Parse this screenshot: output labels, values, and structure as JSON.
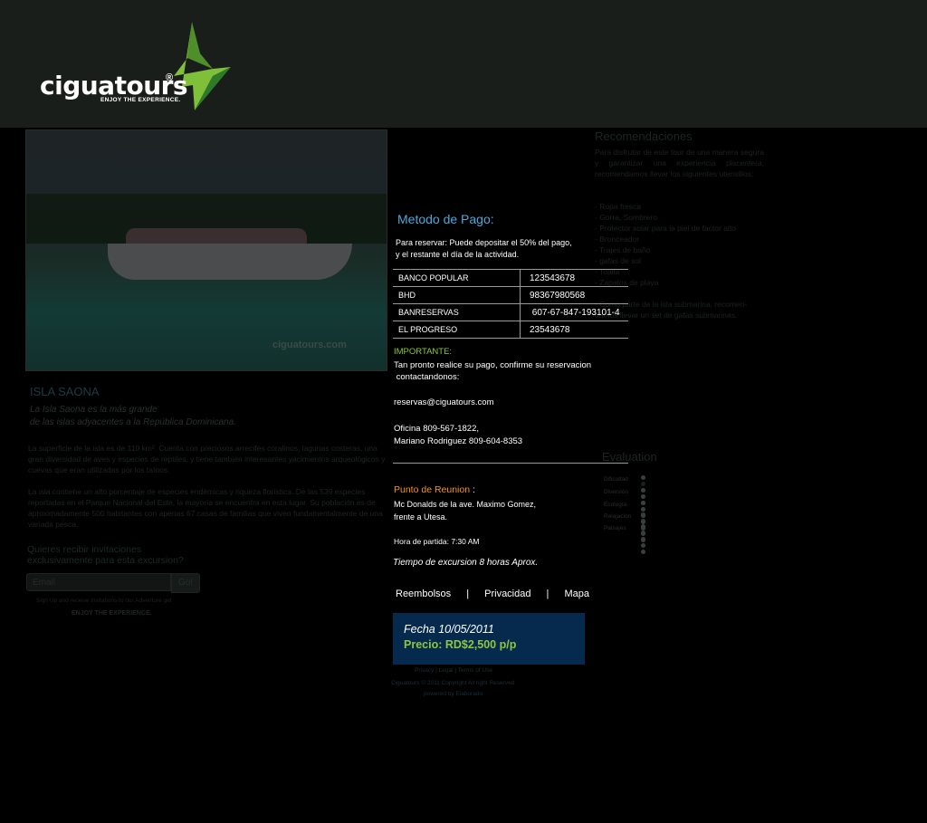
{
  "brand": {
    "logo_text": "ciguatours",
    "logo_mark": "®",
    "tagline": "ENJOY THE EXPERIENCE.",
    "colors": {
      "header_bg": "#1a1e1a",
      "accent_green": "#8ec63f",
      "accent_blue": "#4aa8dc",
      "accent_orange": "#f7941d",
      "price_box": "#062a4e"
    }
  },
  "photo": {
    "watermark": "ciguatours.com"
  },
  "isla": {
    "title": "ISLA SAONA",
    "subtitle_line1": "La Isla Saona es la más grande",
    "subtitle_line2": "de las islas adyacentes a la República Dominicana.",
    "paragraph1": "La superficie de la isla es de 110 km². Cuenta con preciosos arrecifes coralinos, lagunas costeras, una gran diversidad de aves y especies de reptiles, y tiene también interesantes yacimientos arqueológicos y cuevas que eran utilizadas por los taínos.",
    "paragraph2": "La isla contiene un alto porcentaje de especies endémicas y riqueza florística. De las 539 especies reportadas en el Parque Nacional del Este, la mayoría se encuentra en esta lugar. Su población es de aproximadamente 500 habitantes con apenas 67 casas de familias que viven fundamentalmente de una variada pesca."
  },
  "newsletter": {
    "title_line1": "Quieres recibir invitaciones",
    "title_line2": "exclusivamente para esta excursion?",
    "input_placeholder": "Email",
    "button_label": "Go!",
    "note": "Sign Up and receive invitations to our Adventure get",
    "tagline": "ENJOY THE EXPERIENCE."
  },
  "recomendaciones": {
    "title": "Recomendaciones",
    "intro": "Para disfrutar de este tour de una manera segura y garantizar una experiencia placentera, recomendamos llevar los siguientes utensilios:",
    "items": [
      "- Ropa fresca",
      "- Gorra, Sombrero",
      "- Protector solar para la piel de factor alto",
      "- Bronceador",
      "- Trajes de baño",
      "- gafas de sol",
      "- Toalla",
      "- Zapatos de playa"
    ],
    "note_line1": "- Como parte de la isla submarina, recomen-",
    "note_line2": "damos llevar un set de gafas submarinas."
  },
  "evaluation": {
    "title": "Evaluation",
    "rows": [
      {
        "label": "Dificultad",
        "level": 1
      },
      {
        "label": "Diversión",
        "level": 5
      },
      {
        "label": "Ecología",
        "level": 5
      },
      {
        "label": "Relajación",
        "level": 5
      },
      {
        "label": "Paisajes",
        "level": 5
      }
    ]
  },
  "payment": {
    "title": "Metodo de Pago:",
    "intro_line1": "Para reservar:  Puede depositar el 50% del pago,",
    "intro_line2": "y el restante el día de la actividad.",
    "banks": [
      {
        "name": "BANCO POPULAR",
        "account": "123543678"
      },
      {
        "name": "BHD",
        "account": "98367980568"
      },
      {
        "name": "BANRESERVAS",
        "account": " 607-67-847-193101-4"
      },
      {
        "name": "EL PROGRESO",
        "account": "23543678"
      }
    ],
    "important_label": "IMPORTANTE:",
    "confirm_line1": "Tan pronto realice su pago,  confirme su reservacion",
    "confirm_line2": " contactandonos:",
    "email": "reservas@ciguatours.com",
    "office_line1": "Oficina 809-567-1822,",
    "office_line2": "Mariano Rodriguez  809-604-8353"
  },
  "meeting": {
    "title": "Punto de Reunion",
    "colon": " :",
    "address_line1": "Mc Donalds de la ave. Maximo Gomez,",
    "address_line2": "frente a Utesa.",
    "departure": "Hora de partida: 7:30 AM",
    "duration": "Tiempo de excursion 8 horas Aprox."
  },
  "links": {
    "refunds": "Reembolsos",
    "privacy": "Privacidad",
    "map": "Mapa",
    "separator": "|"
  },
  "price": {
    "date": "Fecha 10/05/2011",
    "price": "Precio: RD$2,500 p/p"
  },
  "footer": {
    "links": "Privacy  |  Legal  |  Terms of Use",
    "copyright": "Ciguatours © 2011 Copyright All right Reserved",
    "powered": "powered by",
    "powered_name": "Elaborado"
  }
}
